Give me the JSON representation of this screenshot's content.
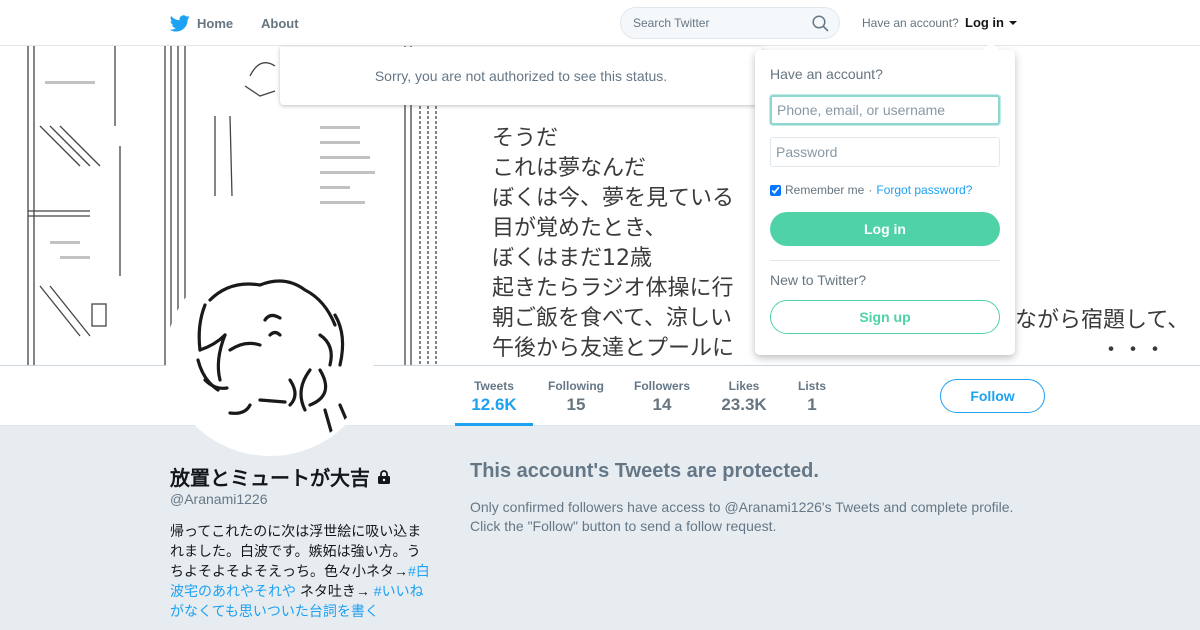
{
  "nav": {
    "home_label": "Home",
    "about_label": "About",
    "search_placeholder": "Search Twitter",
    "have_account": "Have an account?",
    "login_label": "Log in"
  },
  "banner": {
    "text_lines": [
      "そうだ",
      "これは夢なんだ",
      "ぼくは今、夢を見ている",
      "目が覚めたとき、",
      "ぼくはまだ12歳",
      "起きたらラジオ体操に行",
      "朝ご飯を食べて、涼しい",
      "午後から友達とプールに"
    ],
    "text_right": "ながら宿題して、",
    "text_bottom": "・・・"
  },
  "sorry_message": "Sorry, you are not authorized to see this status.",
  "profile_nav": {
    "stats": [
      {
        "label": "Tweets",
        "value": "12.6K",
        "active": true
      },
      {
        "label": "Following",
        "value": "15",
        "active": false
      },
      {
        "label": "Followers",
        "value": "14",
        "active": false
      },
      {
        "label": "Likes",
        "value": "23.3K",
        "active": false
      },
      {
        "label": "Lists",
        "value": "1",
        "active": false
      }
    ],
    "follow_label": "Follow"
  },
  "profile": {
    "name": "放置とミュートが大吉",
    "handle": "@Aranami1226",
    "bio_text1": "帰ってこれたのに次は浮世絵に吸い込まれました。白波です。嫉妬は強い方。うちよそよそよそえっち。色々小ネタ→",
    "bio_tag1": "#白波宅のあれやそれや",
    "bio_text2": " ネタ吐き→ ",
    "bio_tag2": "#いいねがなくても思いついた台詞を書く"
  },
  "protected": {
    "title": "This account's Tweets are protected.",
    "line1": "Only confirmed followers have access to @Aranami1226's Tweets and complete profile.",
    "line2": "Click the \"Follow\" button to send a follow request."
  },
  "login_dropdown": {
    "title": "Have an account?",
    "username_placeholder": "Phone, email, or username",
    "password_placeholder": "Password",
    "remember_label": "Remember me",
    "separator": " · ",
    "forgot_label": "Forgot password?",
    "login_button": "Log in",
    "new_prompt": "New to Twitter?",
    "signup_button": "Sign up"
  },
  "colors": {
    "twitter_blue": "#1da1f2",
    "login_green": "#50d2a8",
    "muted_gray": "#657786",
    "page_bg": "#e6ecf0"
  }
}
